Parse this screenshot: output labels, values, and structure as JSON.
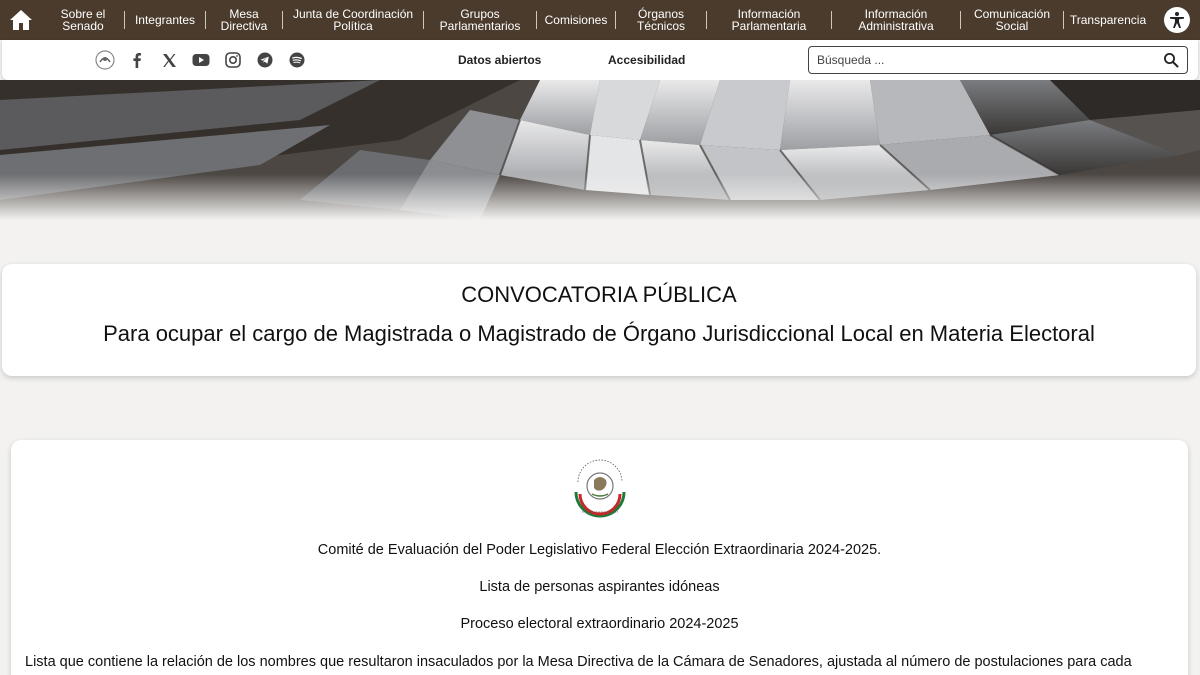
{
  "nav": {
    "items": [
      {
        "label": "Sobre el\nSenado"
      },
      {
        "label": "Integrantes"
      },
      {
        "label": "Mesa\nDirectiva"
      },
      {
        "label": "Junta de Coordinación\nPolítica"
      },
      {
        "label": "Grupos\nParlamentarios"
      },
      {
        "label": "Comisiones"
      },
      {
        "label": "Órganos\nTécnicos"
      },
      {
        "label": "Información\nParlamentaria"
      },
      {
        "label": "Información\nAdministrativa"
      },
      {
        "label": "Comunicación\nSocial"
      },
      {
        "label": "Transparencia"
      }
    ],
    "colors": {
      "bar": "#4a3b2c",
      "text": "#ffffff"
    }
  },
  "subbar": {
    "social_icons": [
      "senado-logo-icon",
      "facebook-icon",
      "x-icon",
      "youtube-icon",
      "instagram-icon",
      "telegram-icon",
      "spotify-icon"
    ],
    "links": {
      "open_data": "Datos abiertos",
      "accessibility": "Accesibilidad"
    },
    "search": {
      "placeholder": "Búsqueda ..."
    }
  },
  "title_card": {
    "heading": "CONVOCATORIA PÚBLICA",
    "subheading": "Para ocupar el cargo de Magistrada o Magistrado de Órgano Jurisdiccional Local en Materia Electoral"
  },
  "content": {
    "seal_text": "SENADO DE LA REPÚBLICA · LXVI LEGISLATURA",
    "committee": "Comité de Evaluación del Poder Legislativo Federal Elección Extraordinaria 2024-2025.",
    "list_title": "Lista de personas aspirantes idóneas",
    "process": "Proceso electoral extraordinario 2024-2025",
    "intro": "Lista que contiene la relación de los nombres que resultaron insaculados por la Mesa Directiva de la Cámara de Senadores, ajustada al número de postulaciones para cada"
  }
}
